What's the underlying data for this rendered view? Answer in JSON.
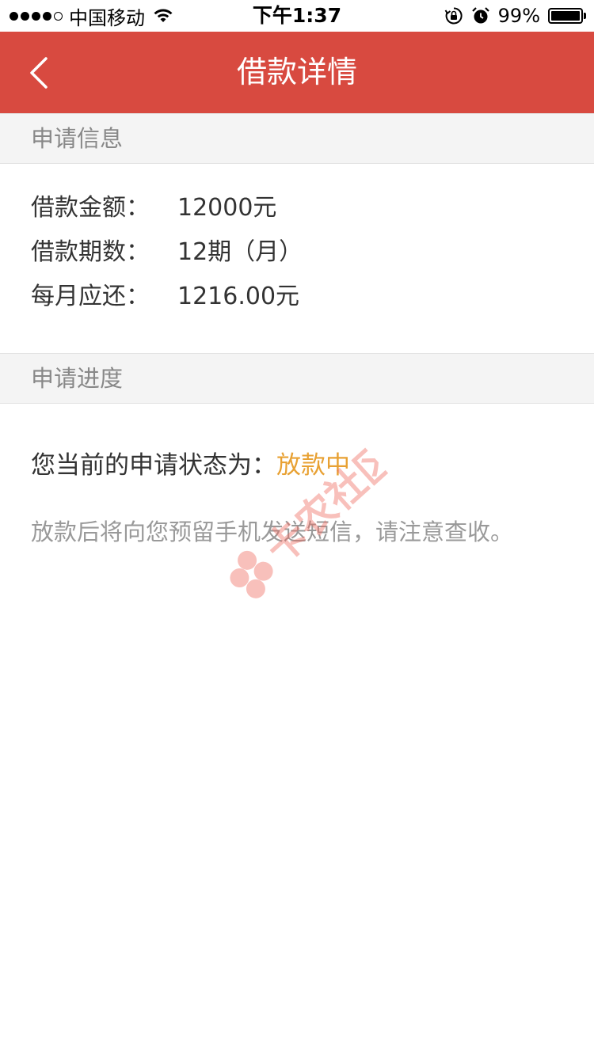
{
  "status_bar": {
    "carrier": "中国移动",
    "time": "下午1:37",
    "battery_text": "99%",
    "battery_level": 0.99,
    "signal_bars": 4,
    "signal_total": 5
  },
  "nav": {
    "title": "借款详情",
    "back_icon": "chevron-left-icon"
  },
  "sections": {
    "apply_info": {
      "header": "申请信息",
      "rows": [
        {
          "label": "借款金额：",
          "value": "12000元"
        },
        {
          "label": "借款期数：",
          "value": "12期（月）"
        },
        {
          "label": "每月应还：",
          "value": "1216.00元"
        }
      ]
    },
    "apply_progress": {
      "header": "申请进度",
      "status_label": "您当前的申请状态为：",
      "status_value": "放款中",
      "notice": "放款后将向您预留手机发送短信，请注意查收。"
    }
  },
  "watermark_text": "卡农社区",
  "colors": {
    "nav_bg": "#d84a40",
    "status_value": "#e8a133",
    "section_bg": "#f4f4f4",
    "watermark": "#f06a60"
  }
}
